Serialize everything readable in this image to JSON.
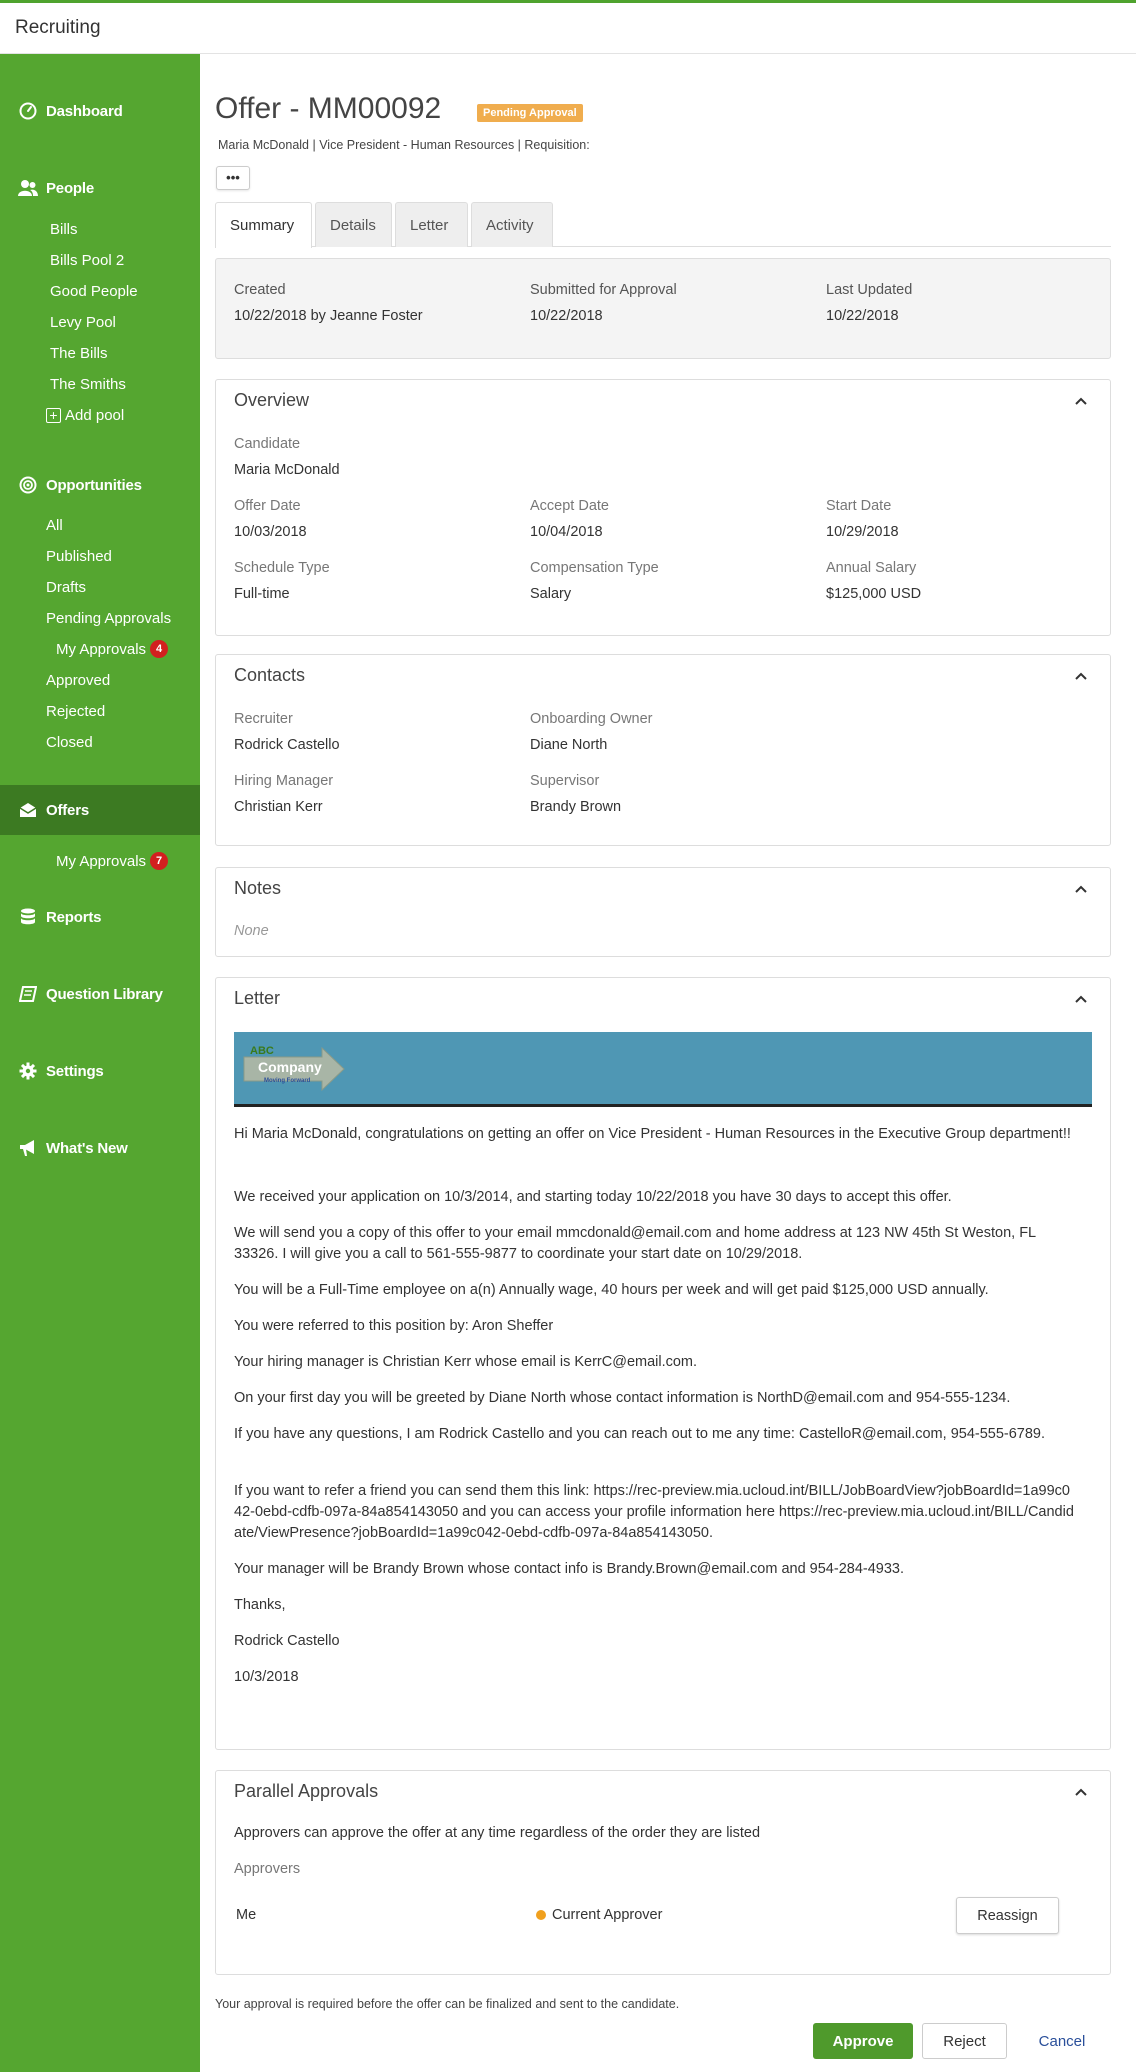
{
  "app": {
    "title": "Recruiting"
  },
  "colors": {
    "brand_green": "#55a630",
    "active_nav": "#3c7a22",
    "badge_red": "#d21f1f",
    "pending_orange": "#f0ad4e",
    "banner_blue": "#4f97b4"
  },
  "sidebar": {
    "dashboard": "Dashboard",
    "people": {
      "label": "People",
      "items": [
        "Bills",
        "Bills Pool 2",
        "Good People",
        "Levy Pool",
        "The Bills",
        "The Smiths"
      ],
      "add_pool": "Add pool"
    },
    "opportunities": {
      "label": "Opportunities",
      "all": "All",
      "published": "Published",
      "drafts": "Drafts",
      "pending": "Pending Approvals",
      "my_approvals": "My Approvals",
      "my_approvals_count": "4",
      "approved": "Approved",
      "rejected": "Rejected",
      "closed": "Closed"
    },
    "offers": {
      "label": "Offers",
      "my_approvals": "My Approvals",
      "my_approvals_count": "7"
    },
    "reports": "Reports",
    "question_library": "Question Library",
    "settings": "Settings",
    "whats_new": "What's New",
    "icons": [
      "dashboard-gauge-icon",
      "people-icon",
      "target-icon",
      "envelope-icon",
      "database-icon",
      "book-icon",
      "gear-icon",
      "megaphone-icon"
    ]
  },
  "offer": {
    "title": "Offer - MM00092",
    "status": "Pending Approval",
    "subline": "Maria McDonald | Vice President - Human Resources | Requisition:",
    "more_label": "•••"
  },
  "tabs": [
    "Summary",
    "Details",
    "Letter",
    "Activity"
  ],
  "meta": {
    "created_label": "Created",
    "created_value": "10/22/2018 by Jeanne Foster",
    "submitted_label": "Submitted for Approval",
    "submitted_value": "10/22/2018",
    "updated_label": "Last Updated",
    "updated_value": "10/22/2018"
  },
  "overview": {
    "title": "Overview",
    "candidate_label": "Candidate",
    "candidate_value": "Maria McDonald",
    "offer_date_label": "Offer Date",
    "offer_date_value": "10/03/2018",
    "accept_date_label": "Accept Date",
    "accept_date_value": "10/04/2018",
    "start_date_label": "Start Date",
    "start_date_value": "10/29/2018",
    "schedule_label": "Schedule Type",
    "schedule_value": "Full-time",
    "comp_label": "Compensation Type",
    "comp_value": "Salary",
    "salary_label": "Annual Salary",
    "salary_value": "$125,000 USD"
  },
  "contacts": {
    "title": "Contacts",
    "recruiter_label": "Recruiter",
    "recruiter_value": "Rodrick Castello",
    "onboarding_label": "Onboarding Owner",
    "onboarding_value": "Diane North",
    "hiring_label": "Hiring Manager",
    "hiring_value": "Christian Kerr",
    "supervisor_label": "Supervisor",
    "supervisor_value": "Brandy Brown"
  },
  "notes": {
    "title": "Notes",
    "value": "None"
  },
  "letter": {
    "title": "Letter",
    "logo_abc": "ABC",
    "logo_company": "Company",
    "logo_tagline": "Moving Forward",
    "paragraphs": [
      "Hi Maria McDonald, congratulations on getting an offer on Vice President - Human Resources in the Executive Group department!!",
      "We received your application on 10/3/2014, and starting today 10/22/2018 you have 30 days to accept this offer.",
      "We will send you a copy of this offer to your email mmcdonald@email.com and home address at 123 NW 45th St Weston, FL 33326. I will give you a call to 561-555-9877 to coordinate your start date on 10/29/2018.",
      "You will be a Full-Time employee on a(n) Annually wage, 40 hours per week and will get paid $125,000 USD annually.",
      "You were referred to this position by: Aron Sheffer",
      "Your hiring manager is Christian Kerr whose email is KerrC@email.com.",
      "On your first day you will be greeted by Diane North whose contact information is NorthD@email.com and 954-555-1234.",
      "If you have any questions, I am Rodrick Castello and you can reach out to me any time: CastelloR@email.com, 954-555-6789.",
      "If you want to refer a friend you can send them this link: https://rec-preview.mia.ucloud.int/BILL/JobBoardView?jobBoardId=1a99c042-0ebd-cdfb-097a-84a854143050 and you can access your profile information here https://rec-preview.mia.ucloud.int/BILL/Candidate/ViewPresence?jobBoardId=1a99c042-0ebd-cdfb-097a-84a854143050.",
      "Your manager will be Brandy Brown whose contact info is Brandy.Brown@email.com and 954-284-4933.",
      "Thanks,",
      "Rodrick Castello",
      "10/3/2018"
    ]
  },
  "parallel": {
    "title": "Parallel Approvals",
    "description": "Approvers can approve the offer at any time regardless of the order they are listed",
    "approvers_label": "Approvers",
    "approver_name": "Me",
    "approver_status": "Current Approver",
    "reassign_label": "Reassign"
  },
  "footer": {
    "note": "Your approval is required before the offer can be finalized and sent to the candidate.",
    "approve_label": "Approve",
    "reject_label": "Reject",
    "cancel_label": "Cancel"
  }
}
